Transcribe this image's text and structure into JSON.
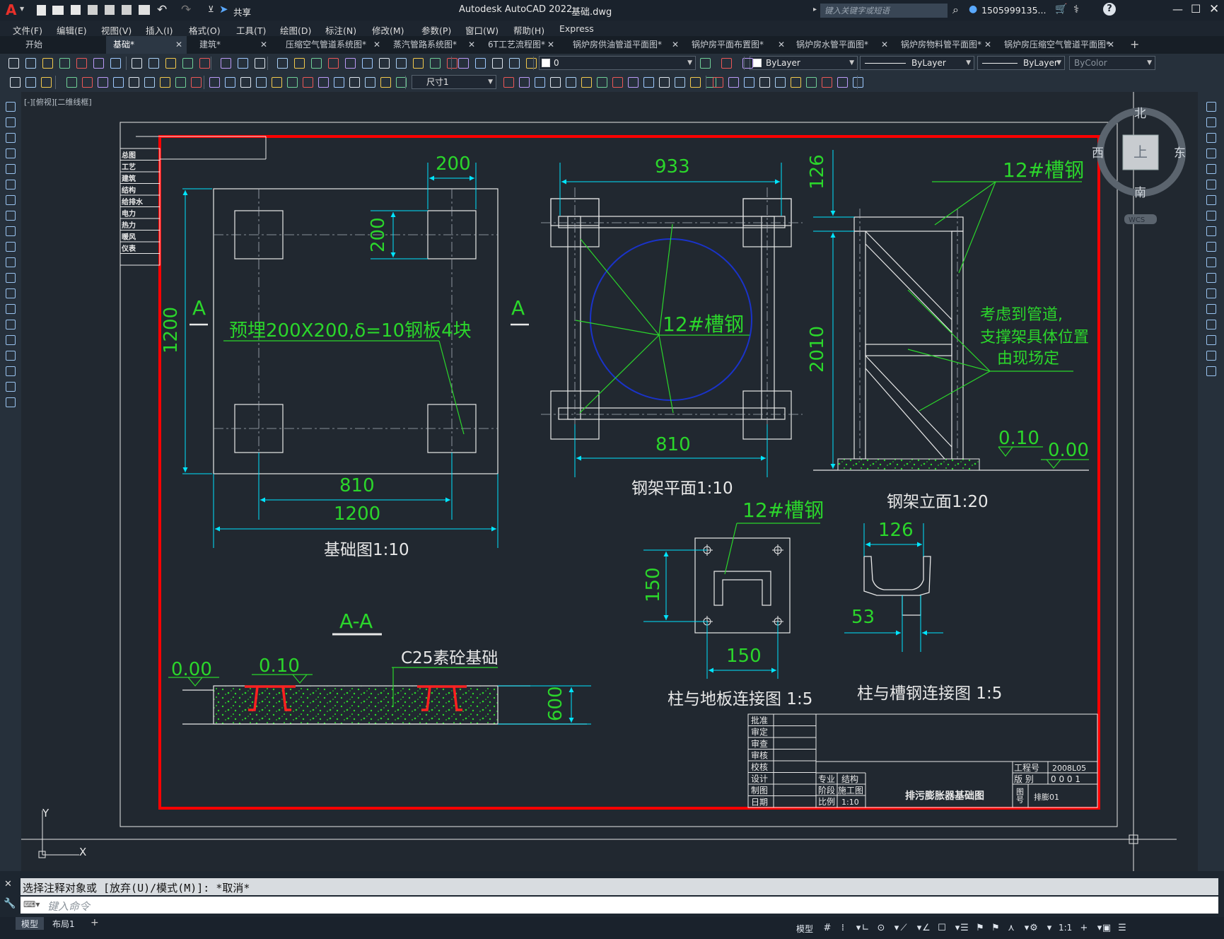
{
  "titlebar": {
    "logo": "A",
    "share_label": "共享",
    "title": "Autodesk AutoCAD 2022",
    "filename": "基础.dwg",
    "search_placeholder": "键入关键字或短语",
    "user": "1505999135...",
    "window_controls": [
      "minimize-icon",
      "maximize-icon",
      "close-icon"
    ]
  },
  "menus": [
    "文件(F)",
    "编辑(E)",
    "视图(V)",
    "插入(I)",
    "格式(O)",
    "工具(T)",
    "绘图(D)",
    "标注(N)",
    "修改(M)",
    "参数(P)",
    "窗口(W)",
    "帮助(H)",
    "Express"
  ],
  "tabs": [
    {
      "label": "开始"
    },
    {
      "label": "基础*",
      "active": true
    },
    {
      "label": "建筑*"
    },
    {
      "label": "压缩空气管道系统图*"
    },
    {
      "label": "蒸汽管路系统图*"
    },
    {
      "label": "6T工艺流程图*"
    },
    {
      "label": "锅炉房供油管道平面图*"
    },
    {
      "label": "锅炉房平面布置图*"
    },
    {
      "label": "锅炉房水管平面图*"
    },
    {
      "label": "锅炉房物料管平面图*"
    },
    {
      "label": "锅炉房压缩空气管道平面图*"
    }
  ],
  "toolbar": {
    "layer": "0",
    "color": "ByLayer",
    "linetype": "ByLayer",
    "lineweight": "ByLayer",
    "plotstyle": "ByColor",
    "dimstyle": "尺寸1"
  },
  "viewport": {
    "label": "[-][俯视][二维线框]"
  },
  "viewcube": {
    "north": "北",
    "south": "南",
    "east": "东",
    "west": "西",
    "top": "上",
    "wcs": "WCS"
  },
  "ucs": {
    "x": "X",
    "y": "Y"
  },
  "drawing": {
    "left_table": [
      "总图",
      "工艺",
      "建筑",
      "结构",
      "给排水",
      "电力",
      "热力",
      "暖风",
      "仪表"
    ],
    "foundation": {
      "dim_200_h": "200",
      "dim_200_v": "200",
      "dim_1200_v": "1200",
      "section_mark_left": "A",
      "section_mark_right": "A",
      "note": "预埋200X200,δ=10钢板4块",
      "dim_810": "810",
      "dim_1200_h": "1200",
      "caption": "基础图1:10"
    },
    "frame_plan": {
      "dim_933": "933",
      "label": "12#槽钢",
      "dim_810": "810",
      "caption": "钢架平面1:10"
    },
    "frame_elev": {
      "dim_126": "126",
      "label": "12#槽钢",
      "dim_2010": "2010",
      "note_line1": "考虑到管道,",
      "note_line2": "支撑架具体位置",
      "note_line3": "由现场定",
      "elev_010": "0.10",
      "elev_000": "0.00",
      "caption": "钢架立面1:20"
    },
    "section": {
      "title": "A-A",
      "elev_000": "0.00",
      "elev_010": "0.10",
      "note": "C25素砼基础",
      "dim_600": "600"
    },
    "conn1": {
      "label": "12#槽钢",
      "dim_150_v": "150",
      "dim_150_h": "150",
      "caption": "柱与地板连接图 1:5"
    },
    "conn2": {
      "dim_126": "126",
      "dim_53": "53",
      "caption": "柱与槽钢连接图 1:5"
    },
    "titleblock": {
      "roles": [
        "批准",
        "审定",
        "审查",
        "审核",
        "校核",
        "设计",
        "制图",
        "日期"
      ],
      "major_label": "专业",
      "major_value": "结构",
      "stage_label": "阶段",
      "stage_value": "施工图",
      "scale_label": "比例",
      "scale_value": "1:10",
      "drawing_name": "排污膨胀器基础图",
      "project_no_label": "工程号",
      "project_no": "2008L05",
      "version_label": "版 别",
      "version_value": "0 0 0 1",
      "drawing_no_label": "图号",
      "drawing_no": "排膨01"
    }
  },
  "command": {
    "history": "选择注释对象或 [放弃(U)/模式(M)]: *取消*",
    "placeholder": "键入命令"
  },
  "status": {
    "tabs": [
      "模型",
      "布局1"
    ],
    "model_label": "模型",
    "scale": "1:1"
  }
}
